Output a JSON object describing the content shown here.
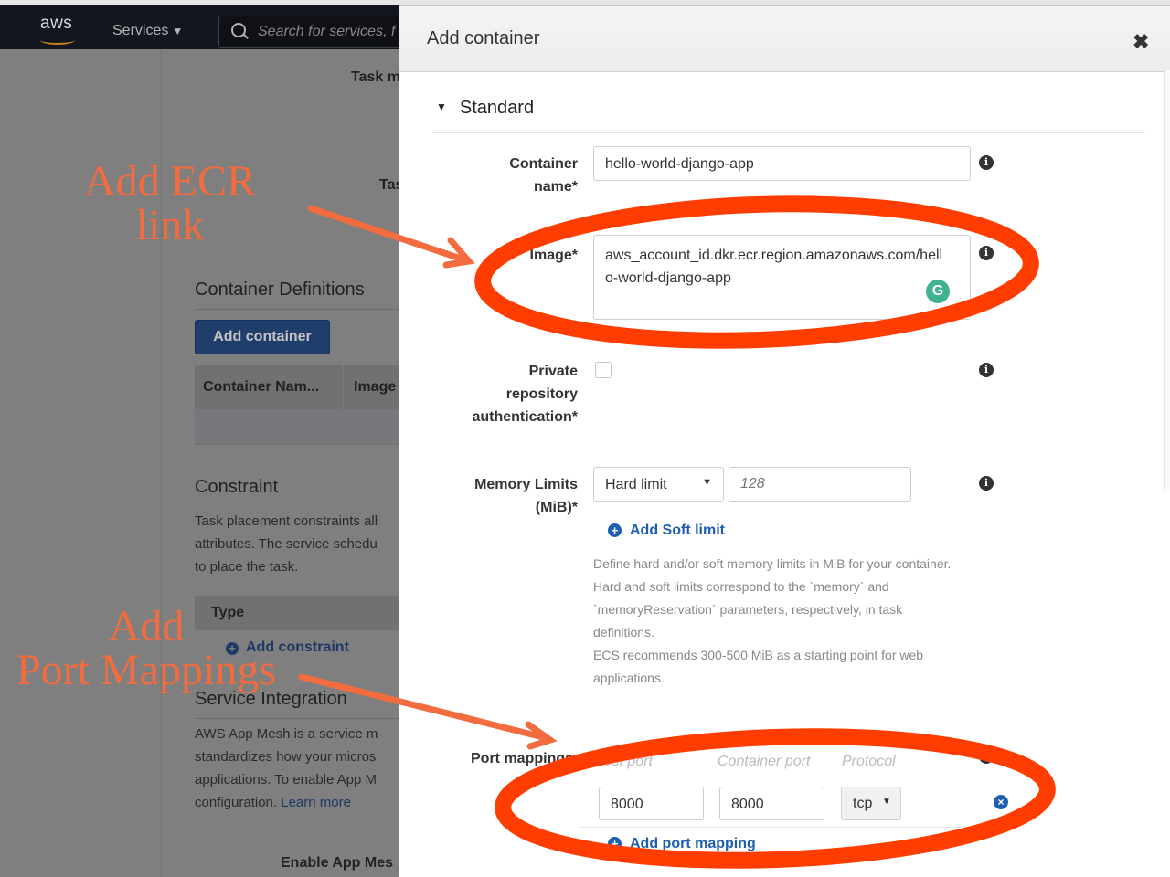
{
  "console": {
    "logo": "aws",
    "services_label": "Services",
    "search_placeholder": "Search for services, f",
    "task_m_label": "Task m",
    "tas_label": "Tas",
    "container_definitions": {
      "heading": "Container Definitions",
      "add_button": "Add container",
      "columns": [
        "Container Nam...",
        "Image"
      ]
    },
    "constraint": {
      "heading": "Constraint",
      "description_lines": [
        "Task placement constraints all",
        "attributes. The service schedu",
        "to place the task."
      ],
      "type_header": "Type",
      "add_link": "Add constraint"
    },
    "service_integration": {
      "heading": "Service Integration",
      "description_lines": [
        "AWS App Mesh is a service m",
        "standardizes how your micros",
        "applications. To enable App M"
      ],
      "last_line_prefix": "configuration. ",
      "learn_more": "Learn more",
      "enable_label": "Enable App Mes"
    }
  },
  "modal": {
    "title": "Add container",
    "close_icon": "close-icon",
    "section": "Standard",
    "container_name": {
      "label_lines": [
        "Container",
        "name*"
      ],
      "value": "hello-world-django-app"
    },
    "image": {
      "label": "Image*",
      "value_lines": [
        "aws_account_id.dkr.ecr.region.amazonaws.com/hell",
        "o-world-django-app"
      ]
    },
    "private_repo": {
      "label_lines": [
        "Private",
        "repository",
        "authentication*"
      ],
      "checked": false
    },
    "memory": {
      "label_lines": [
        "Memory Limits",
        "(MiB)*"
      ],
      "limit_type": "Hard limit",
      "placeholder": "128",
      "add_soft_limit": "Add Soft limit",
      "help_lines": [
        "Define hard and/or soft memory limits in MiB for your container.",
        "Hard and soft limits correspond to the `memory` and",
        "`memoryReservation` parameters, respectively, in task",
        "definitions.",
        "ECS recommends 300-500 MiB as a starting point for web",
        "applications."
      ]
    },
    "port_mappings": {
      "label": "Port mappings",
      "headers": [
        "Host port",
        "Container port",
        "Protocol"
      ],
      "rows": [
        {
          "host_port": "8000",
          "container_port": "8000",
          "protocol": "tcp"
        }
      ],
      "add_link": "Add port mapping"
    }
  },
  "annotations": {
    "ecr": [
      "Add ECR",
      "link"
    ],
    "ports": [
      "Add",
      "Port Mappings"
    ],
    "color": "#f26c3f",
    "circle_color": "#ff3d00"
  }
}
